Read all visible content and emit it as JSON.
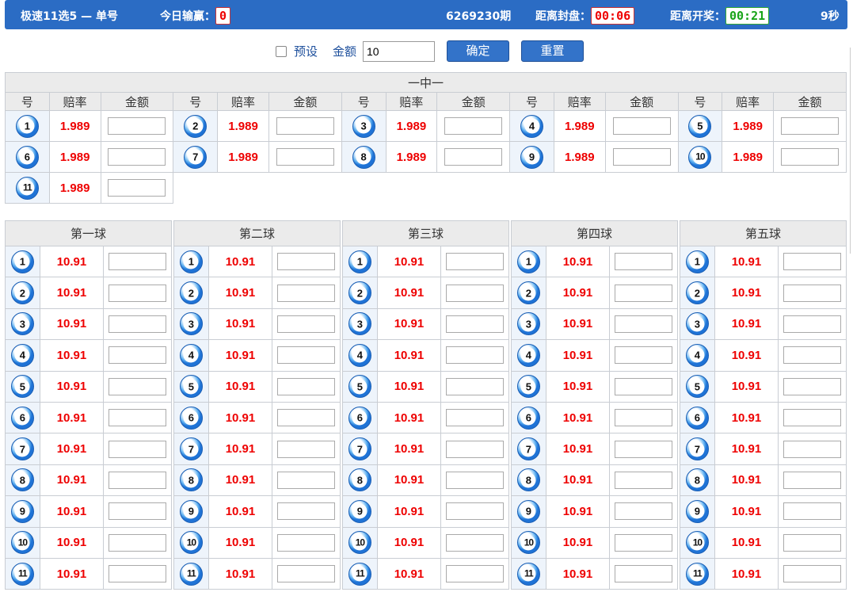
{
  "header": {
    "game": "极速11选5 — 单号",
    "today_label": "今日输赢：",
    "today_value": "0",
    "period": "6269230期",
    "close_label": "距离封盘：",
    "close_time": "00:06",
    "draw_label": "距离开奖：",
    "draw_time": "00:21",
    "countdown": "9秒"
  },
  "toolbar": {
    "preset_label": "预设",
    "amount_label": "金额",
    "amount_value": "10",
    "confirm_label": "确定",
    "reset_label": "重置"
  },
  "one_in_one": {
    "title": "一中一",
    "col_headers": [
      "号",
      "赔率",
      "金额"
    ],
    "items": [
      {
        "num": "1",
        "odds": "1.989"
      },
      {
        "num": "2",
        "odds": "1.989"
      },
      {
        "num": "3",
        "odds": "1.989"
      },
      {
        "num": "4",
        "odds": "1.989"
      },
      {
        "num": "5",
        "odds": "1.989"
      },
      {
        "num": "6",
        "odds": "1.989"
      },
      {
        "num": "7",
        "odds": "1.989"
      },
      {
        "num": "8",
        "odds": "1.989"
      },
      {
        "num": "9",
        "odds": "1.989"
      },
      {
        "num": "10",
        "odds": "1.989"
      },
      {
        "num": "11",
        "odds": "1.989"
      }
    ]
  },
  "balls": [
    {
      "title": "第一球",
      "odds": [
        "10.91",
        "10.91",
        "10.91",
        "10.91",
        "10.91",
        "10.91",
        "10.91",
        "10.91",
        "10.91",
        "10.91",
        "10.91"
      ]
    },
    {
      "title": "第二球",
      "odds": [
        "10.91",
        "10.91",
        "10.91",
        "10.91",
        "10.91",
        "10.91",
        "10.91",
        "10.91",
        "10.91",
        "10.91",
        "10.91"
      ]
    },
    {
      "title": "第三球",
      "odds": [
        "10.91",
        "10.91",
        "10.91",
        "10.91",
        "10.91",
        "10.91",
        "10.91",
        "10.91",
        "10.91",
        "10.91",
        "10.91"
      ]
    },
    {
      "title": "第四球",
      "odds": [
        "10.91",
        "10.91",
        "10.91",
        "10.91",
        "10.91",
        "10.91",
        "10.91",
        "10.91",
        "10.91",
        "10.91",
        "10.91"
      ]
    },
    {
      "title": "第五球",
      "odds": [
        "10.91",
        "10.91",
        "10.91",
        "10.91",
        "10.91",
        "10.91",
        "10.91",
        "10.91",
        "10.91",
        "10.91",
        "10.91"
      ]
    }
  ],
  "numbers": [
    "1",
    "2",
    "3",
    "4",
    "5",
    "6",
    "7",
    "8",
    "9",
    "10",
    "11"
  ],
  "colors": {
    "accent": "#2b6cc4",
    "odds": "#e00000",
    "draw_time": "#18a318"
  }
}
